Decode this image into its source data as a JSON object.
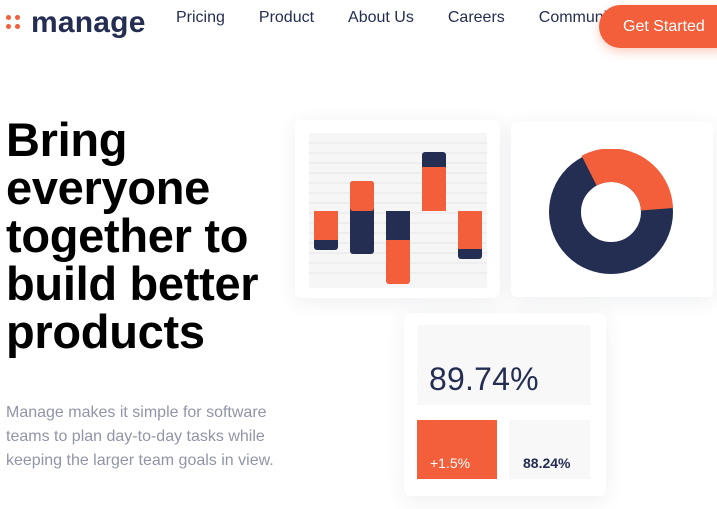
{
  "header": {
    "logo_text": "manage",
    "nav": [
      "Pricing",
      "Product",
      "About Us",
      "Careers",
      "Community"
    ],
    "cta_label": "Get Started"
  },
  "hero": {
    "headline": "Bring everyone together to build better products",
    "subtext": "Manage makes it simple for software teams to plan day-to-day tasks while keeping the larger team goals in view."
  },
  "colors": {
    "accent": "#f25f3a",
    "navy": "#242d52",
    "muted_text": "#9095a7",
    "panel": "#f8f8f8"
  },
  "illustration": {
    "stats": {
      "main_value": "89.74%",
      "change_value": "+1.5%",
      "secondary_value": "88.24%"
    },
    "donut": {
      "orange_share": 0.33,
      "navy_share": 0.67
    }
  },
  "icons": [
    "logo-dots-icon"
  ]
}
